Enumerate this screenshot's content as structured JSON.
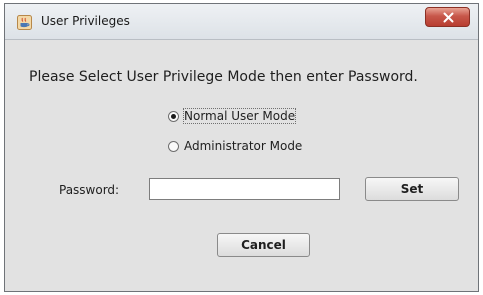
{
  "window": {
    "title": "User Privileges",
    "close_label": "X"
  },
  "dialog": {
    "instruction": "Please Select User Privilege Mode then enter Password.",
    "modes": [
      {
        "label": "Normal User Mode",
        "selected": true
      },
      {
        "label": "Administrator Mode",
        "selected": false
      }
    ],
    "password_label": "Password:",
    "password_value": "",
    "set_label": "Set",
    "cancel_label": "Cancel"
  },
  "colors": {
    "close_button": "#c7574a",
    "background": "#e2e2e2"
  },
  "icons": {
    "title_icon": "java-app-icon",
    "close_icon": "close-icon"
  }
}
